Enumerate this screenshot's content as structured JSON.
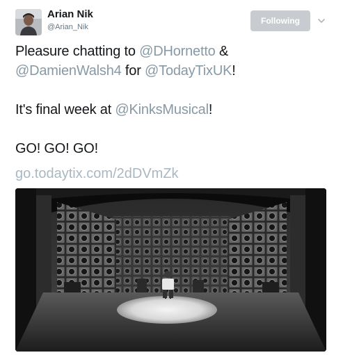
{
  "author": {
    "name": "Arian Nik",
    "handle": "@Arian_Nik"
  },
  "follow_button": {
    "label": "Following"
  },
  "tweet": {
    "line1_text_a": "Pleasure chatting to ",
    "line1_mention_a": "@DHornetto",
    "line1_text_b": " &",
    "line2_mention_a": "@DamienWalsh4",
    "line2_text_a": " for ",
    "line2_mention_b": "@TodayTixUK",
    "line2_text_b": "!",
    "line3_text_a": "It's final week at ",
    "line3_mention_a": "@KinksMusical",
    "line3_text_b": "!",
    "line4_text": "GO! GO! GO!",
    "link": "go.todaytix.com/2dDVmZk"
  },
  "icons": {
    "menu": "chevron-down-icon"
  },
  "colors": {
    "mention": "#8899a6",
    "link": "#aab8c2",
    "following_button": "#c8ccd0"
  }
}
